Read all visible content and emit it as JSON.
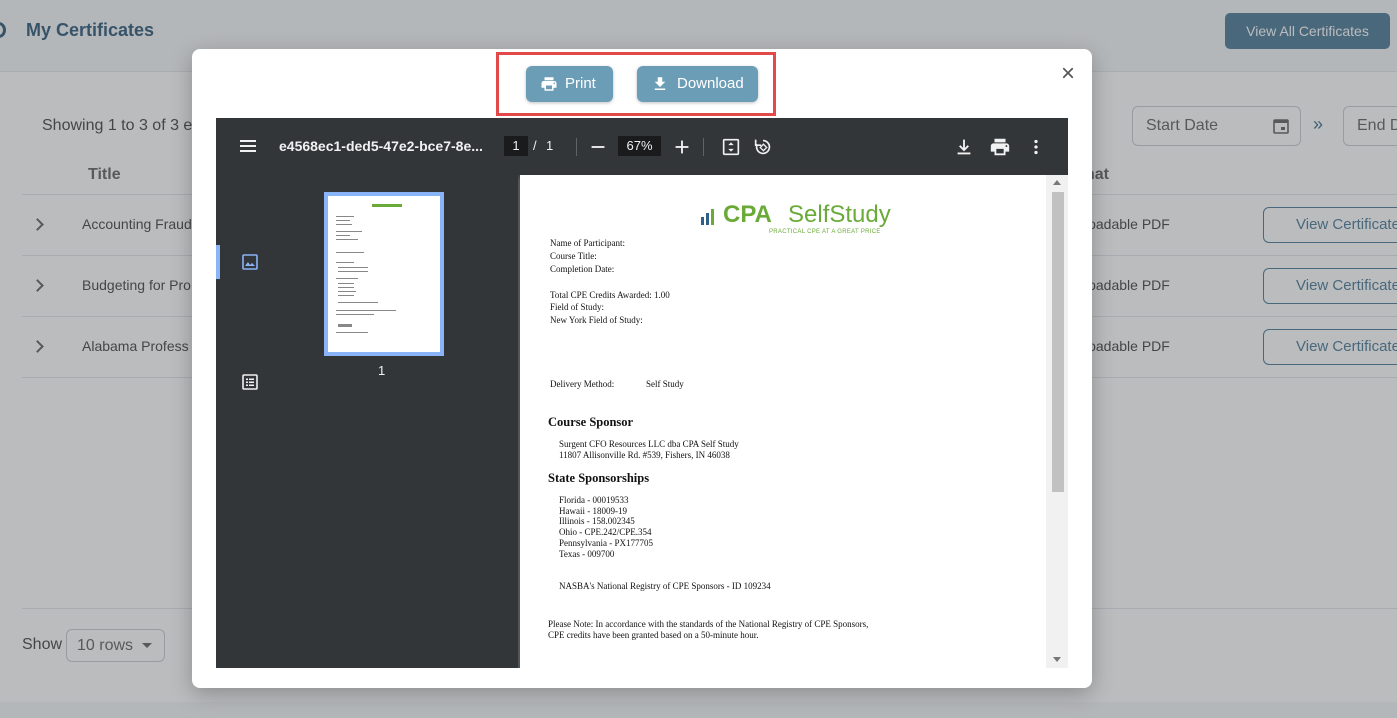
{
  "background": {
    "page_title": "My Certificates",
    "view_all_label": "View All Certificates",
    "showing_text": "Showing 1 to 3 of 3 e",
    "start_date_placeholder": "Start Date",
    "end_date_placeholder": "End D",
    "double_arrow": "»",
    "columns": {
      "title": "Title",
      "format": "nat"
    },
    "rows": [
      {
        "title": "Accounting Fraud",
        "format": "loadable PDF",
        "action": "View Certificate"
      },
      {
        "title": "Budgeting for Pro",
        "format": "loadable PDF",
        "action": "View Certificate"
      },
      {
        "title": "Alabama Profess",
        "format": "loadable PDF",
        "action": "View Certificate"
      }
    ],
    "show_label": "Show",
    "rows_select": "10 rows"
  },
  "modal": {
    "print_label": "Print",
    "download_label": "Download",
    "close_symbol": "×"
  },
  "viewer": {
    "filename": "e4568ec1-ded5-47e2-bce7-8e...",
    "current_page": "1",
    "page_sep": "/",
    "total_pages": "1",
    "zoom": "67%",
    "thumbnail_label": "1"
  },
  "certificate": {
    "logo_cpa": "CPA",
    "logo_selfstudy": "SelfStudy",
    "logo_tagline": "PRACTICAL CPE AT A GREAT PRICE",
    "name_label": "Name of Participant:",
    "course_title_label": "Course Title:",
    "completion_label": "Completion Date:",
    "credits_label": "Total CPE Credits Awarded: 1.00",
    "field_label": "Field of Study:",
    "ny_field_label": "New York Field of Study:",
    "delivery_label": "Delivery Method:",
    "delivery_value": "Self Study",
    "sponsor_heading": "Course Sponsor",
    "sponsor_line1": "Surgent CFO Resources LLC dba CPA Self Study",
    "sponsor_line2": "11807 Allisonville Rd. #539, Fishers, IN 46038",
    "state_heading": "State Sponsorships",
    "states": [
      "Florida - 00019533",
      "Hawaii - 18009-19",
      "Illinois - 158.002345",
      "Ohio - CPE.242/CPE.354",
      "Pennsylvania - PX177705",
      "Texas - 009700"
    ],
    "nasba": "NASBA's National Registry of CPE Sponsors - ID 109234",
    "note_line1": "Please Note: In accordance with the standards of the National Registry of CPE Sponsors,",
    "note_line2": "CPE credits have been granted based on a 50-minute hour."
  },
  "colors": {
    "accent": "#6c9db6",
    "highlight": "#e24a4a",
    "brand_green": "#6aaa39",
    "viewer_toolbar": "#323639"
  }
}
